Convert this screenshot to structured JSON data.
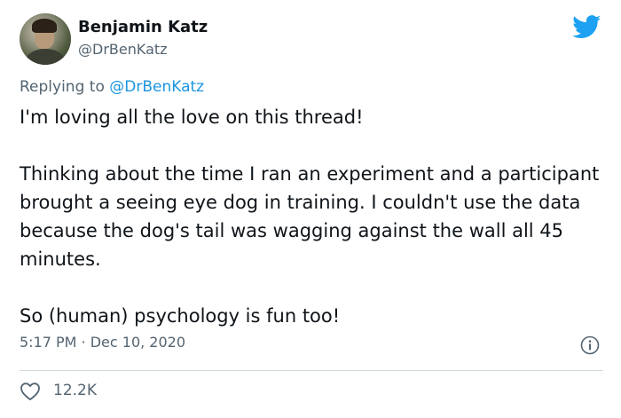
{
  "author": {
    "display_name": "Benjamin Katz",
    "handle": "@DrBenKatz"
  },
  "reply": {
    "prefix": "Replying to ",
    "mention": "@DrBenKatz"
  },
  "tweet": {
    "paragraphs": [
      "I'm loving all the love on this thread!",
      "Thinking about the time I ran an experiment and a participant brought a seeing eye dog in training. I couldn't use the data because the dog's tail was wagging against the wall all 45 minutes.",
      "So (human) psychology is fun too!"
    ],
    "timestamp": "5:17 PM · Dec 10, 2020",
    "like_count": "12.2K"
  },
  "icons": {
    "brand": "twitter-bird-icon",
    "info": "info-icon",
    "like": "heart-icon"
  },
  "colors": {
    "twitter_blue": "#1da1f2",
    "mention": "#1b95e0",
    "secondary_text": "#536471",
    "primary_text": "#0f1419",
    "divider": "#cfd9de"
  }
}
